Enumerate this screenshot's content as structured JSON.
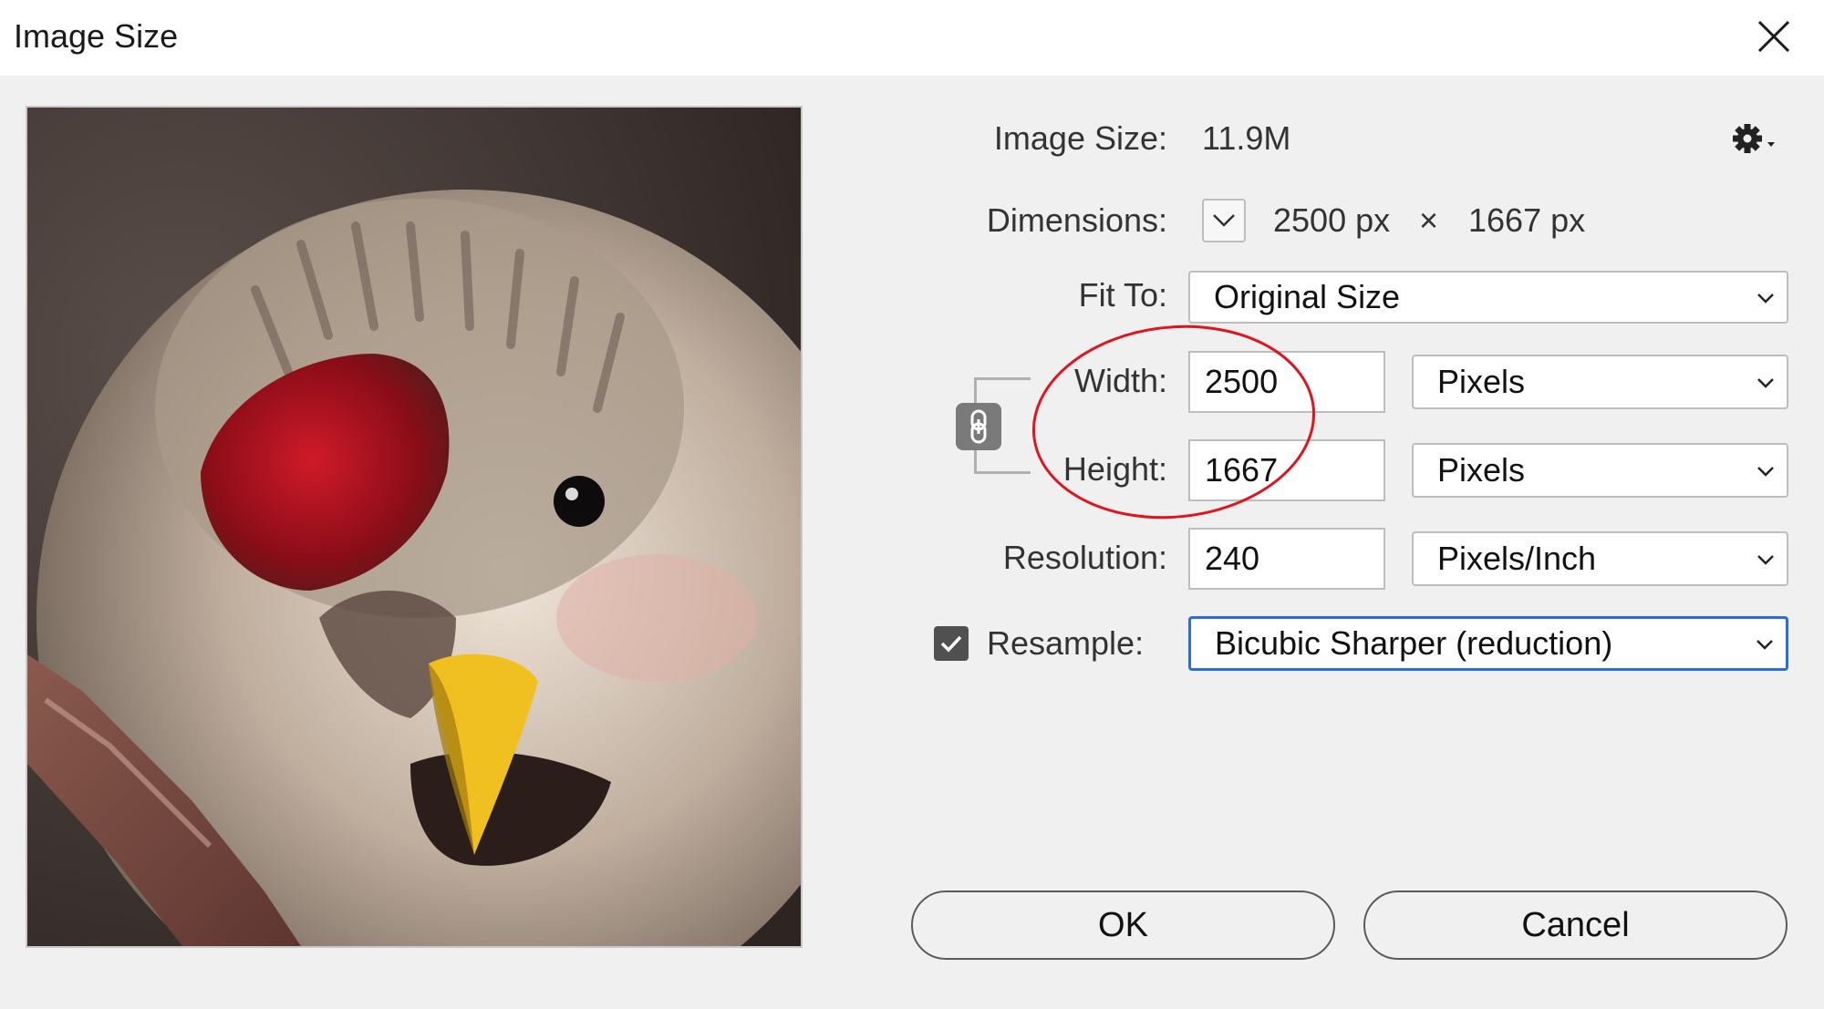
{
  "dialog": {
    "title": "Image Size"
  },
  "info": {
    "image_size_label": "Image Size:",
    "image_size_value": "11.9M",
    "dimensions_label": "Dimensions:",
    "dim_width": "2500 px",
    "dim_times": "×",
    "dim_height": "1667 px"
  },
  "fit_to": {
    "label": "Fit To:",
    "value": "Original Size"
  },
  "width": {
    "label": "Width:",
    "value": "2500",
    "unit": "Pixels"
  },
  "height": {
    "label": "Height:",
    "value": "1667",
    "unit": "Pixels"
  },
  "resolution": {
    "label": "Resolution:",
    "value": "240",
    "unit": "Pixels/Inch"
  },
  "resample": {
    "label": "Resample:",
    "checked": true,
    "value": "Bicubic Sharper (reduction)"
  },
  "buttons": {
    "ok": "OK",
    "cancel": "Cancel"
  },
  "icons": {
    "close": "close-icon",
    "gear": "gear-icon",
    "chain": "chain-link-icon",
    "chevron": "chevron-down-icon",
    "check": "checkmark-icon"
  },
  "colors": {
    "focus_border": "#2a6fd8",
    "annotation_circle": "#e0141e",
    "dialog_bg": "#f0f0f0"
  }
}
